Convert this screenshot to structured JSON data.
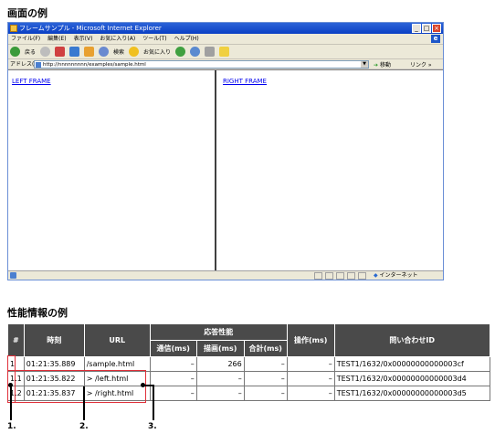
{
  "screen_heading": "画面の例",
  "perf_heading": "性能情報の例",
  "window": {
    "title": "フレームサンプル - Microsoft Internet Explorer",
    "controls": [
      "_",
      "□",
      "×"
    ],
    "menu": [
      "ファイル(F)",
      "編集(E)",
      "表示(V)",
      "お気に入り(A)",
      "ツール(T)",
      "ヘルプ(H)"
    ],
    "toolbar": {
      "back": "戻る",
      "search": "検索",
      "favorites": "お気に入り"
    },
    "address_label": "アドレス(D)",
    "address_value": "http://nnnnnnnnn/examples/sample.html",
    "go_label": "移動",
    "links_label": "リンク »",
    "left_frame_link": "LEFT FRAME",
    "right_frame_link": "RIGHT FRAME",
    "status_zone": "インターネット"
  },
  "table": {
    "headers": {
      "num": "#",
      "time": "時刻",
      "url": "URL",
      "response": "応答性能",
      "comm": "通信(ms)",
      "draw": "描画(ms)",
      "total": "合計(ms)",
      "op": "操作(ms)",
      "query": "問い合わせID"
    },
    "rows": [
      {
        "num": "1",
        "time": "01:21:35.889",
        "url": "/sample.html",
        "comm": "–",
        "draw": "266",
        "total": "–",
        "op": "–",
        "query": "TEST1/1632/0x00000000000003cf"
      },
      {
        "num": "1.1",
        "time": "01:21:35.822",
        "url": "> /left.html",
        "comm": "–",
        "draw": "–",
        "total": "–",
        "op": "–",
        "query": "TEST1/1632/0x00000000000003d4"
      },
      {
        "num": "1.2",
        "time": "01:21:35.837",
        "url": "> /right.html",
        "comm": "–",
        "draw": "–",
        "total": "–",
        "op": "–",
        "query": "TEST1/1632/0x00000000000003d5"
      }
    ]
  },
  "markers": [
    "1.",
    "2.",
    "3."
  ],
  "colors": {
    "highlight": "#e0303a",
    "header_bg": "#4a4a4a",
    "title_bar": "#0a3fc4"
  }
}
